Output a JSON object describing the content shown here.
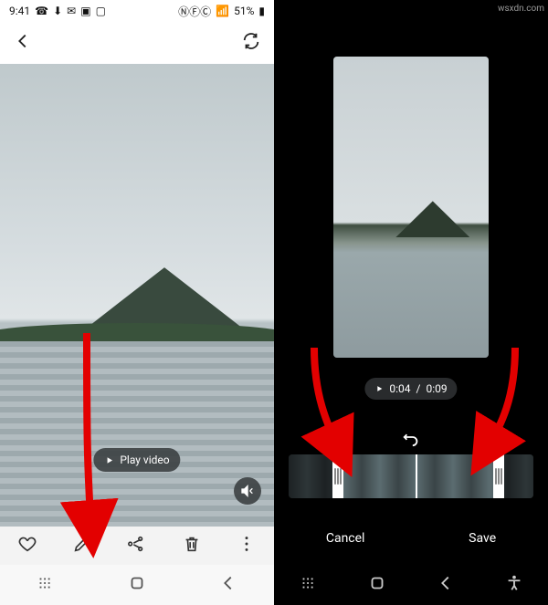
{
  "annotation_watermark": "wsxdn.com",
  "left_screen": {
    "statusbar": {
      "time": "9:41",
      "battery_text": "51%",
      "icons_left": [
        "whatsapp-icon",
        "download-icon",
        "chat-icon",
        "screenshot-icon",
        "gallery-icon"
      ],
      "icons_right": [
        "nfc-icon",
        "volte-icon",
        "signal-icon",
        "battery-icon"
      ]
    },
    "topbar": {
      "back": "Back",
      "smart": "Smart view"
    },
    "play_label": "Play video",
    "bottom_actions": {
      "favorite": "Favorite",
      "edit": "Edit",
      "share": "Share",
      "delete": "Delete",
      "more": "More"
    },
    "nav": {
      "recents": "Recents",
      "home": "Home",
      "back": "Back"
    }
  },
  "right_screen": {
    "time_current": "0:04",
    "time_sep": " / ",
    "time_total": "0:09",
    "reset": "Reset",
    "actions": {
      "cancel": "Cancel",
      "save": "Save"
    },
    "nav": {
      "recents": "Recents",
      "home": "Home",
      "back": "Back",
      "accessibility": "Accessibility"
    }
  }
}
